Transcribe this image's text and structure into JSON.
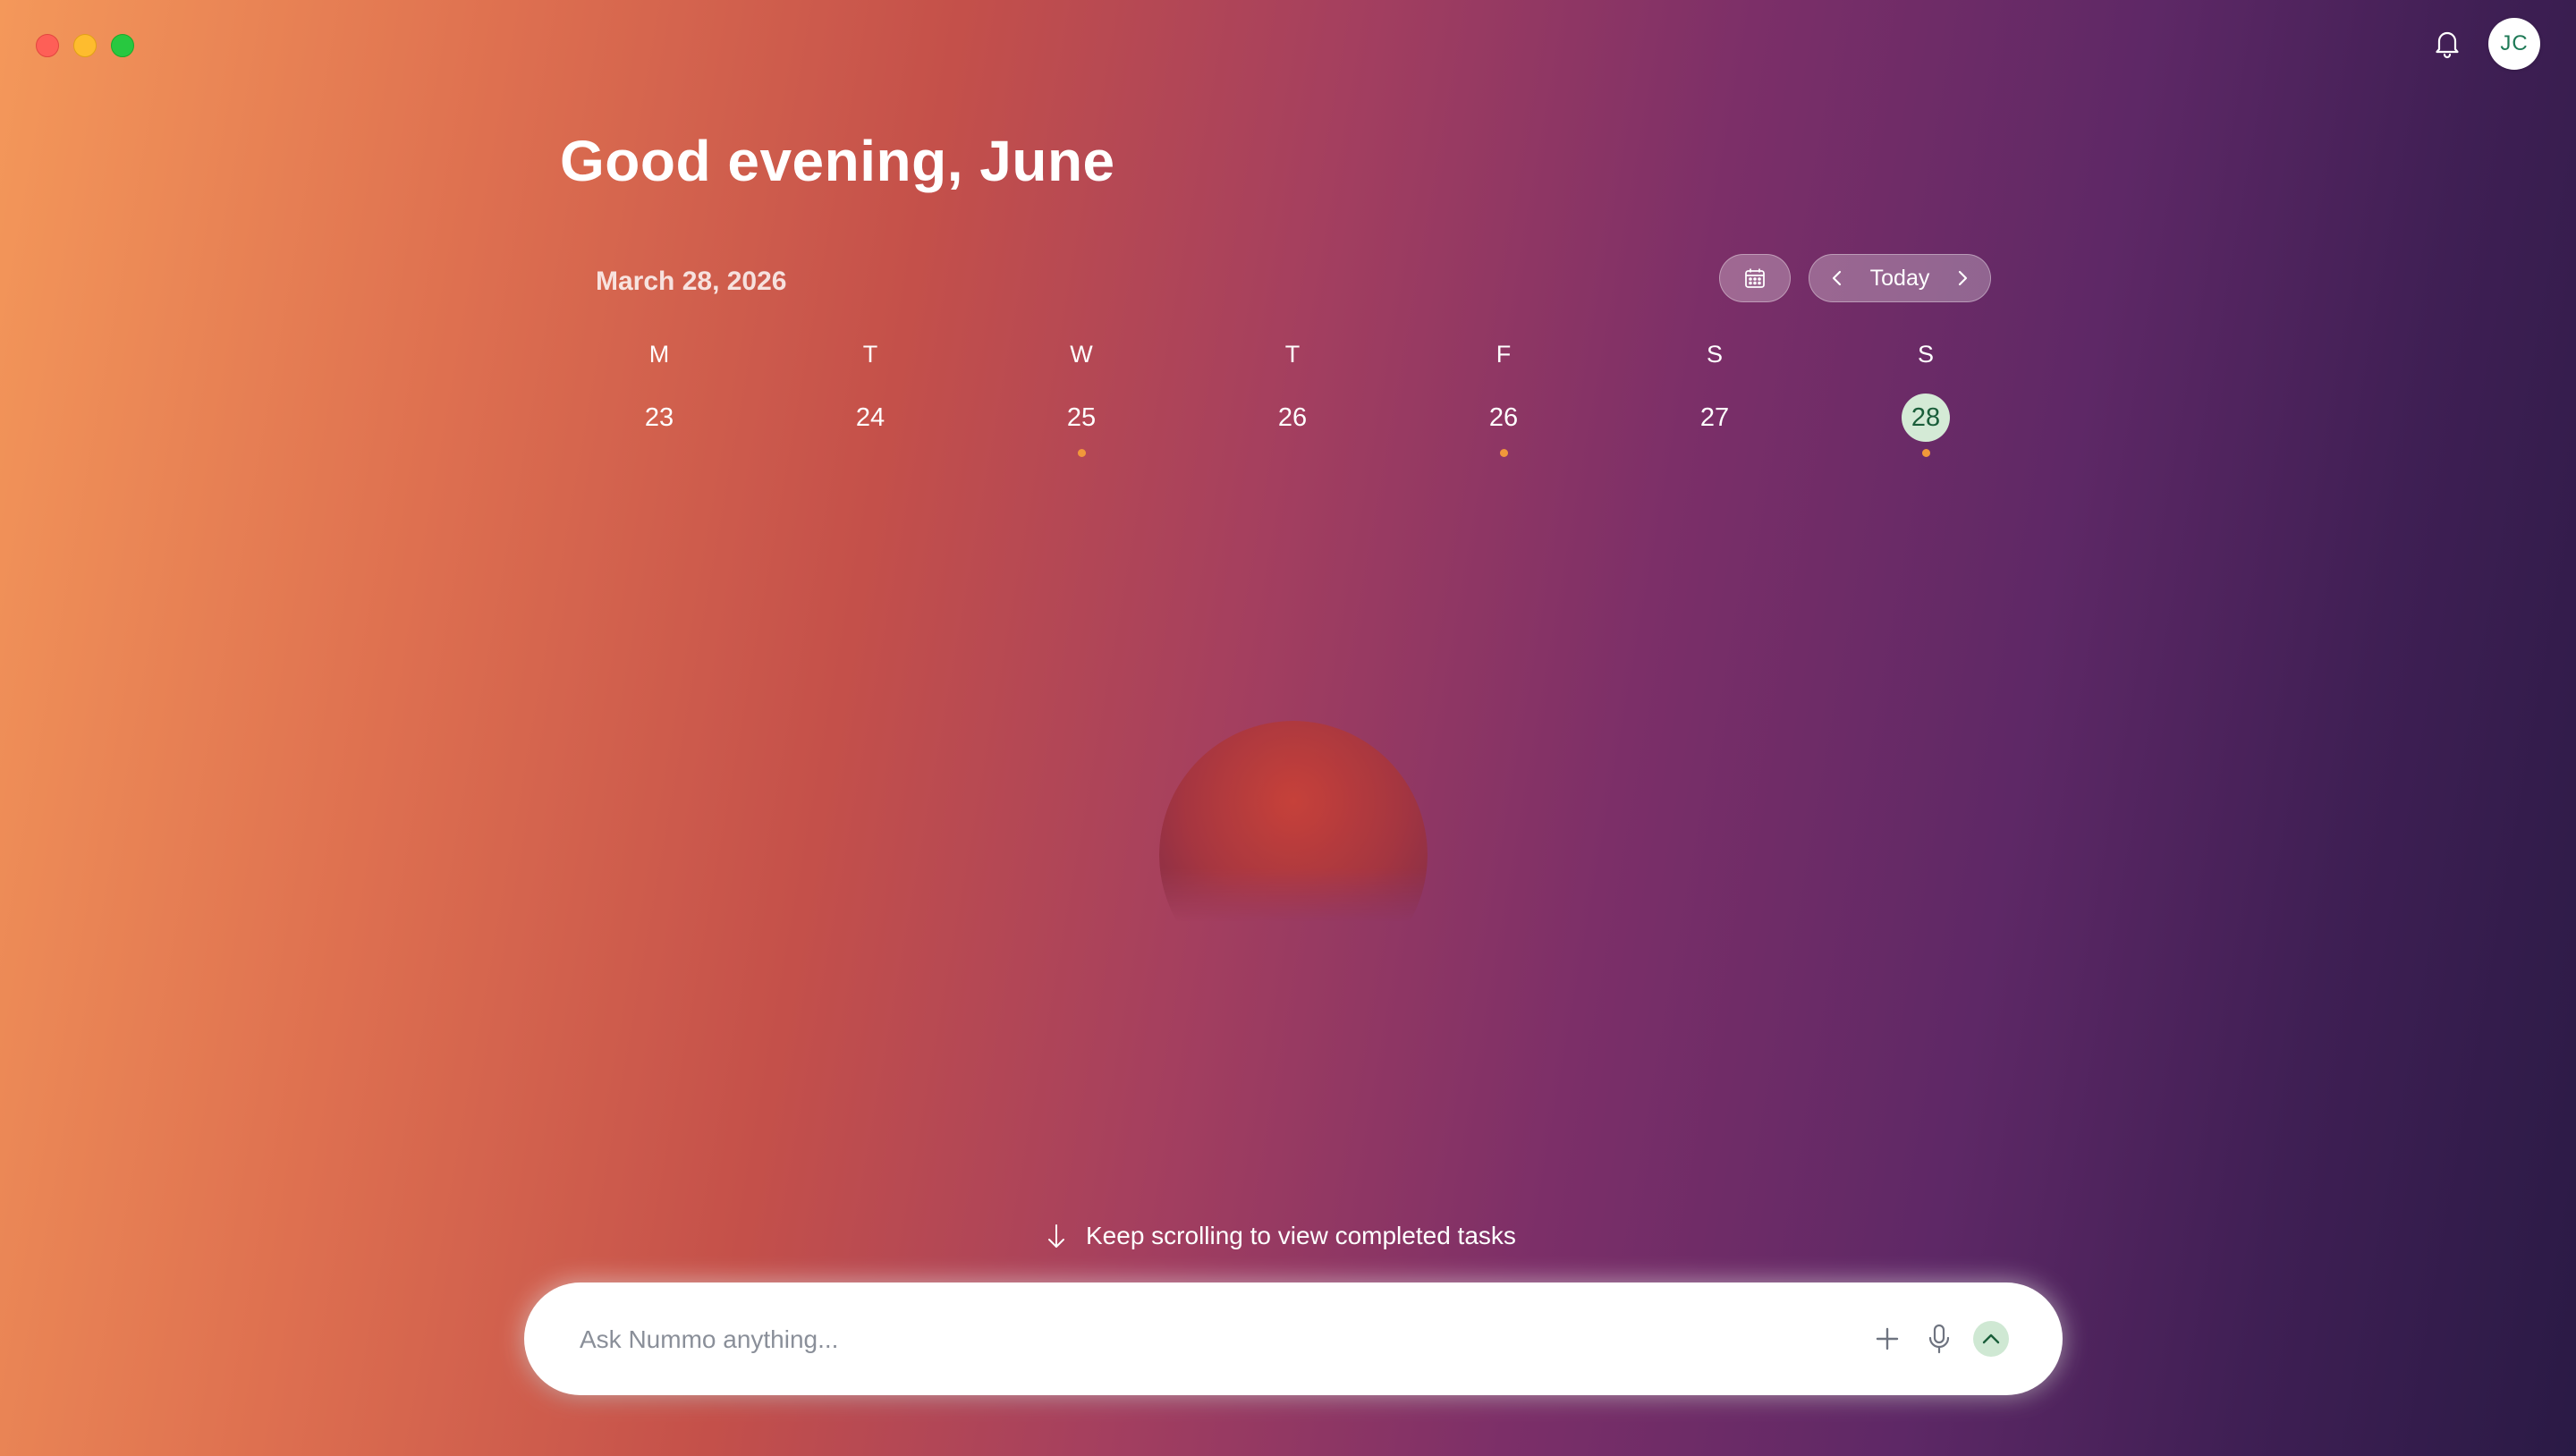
{
  "window": {
    "controls": [
      "close",
      "minimize",
      "maximize"
    ]
  },
  "header": {
    "bell_icon": "bell-icon",
    "avatar_initials": "JC"
  },
  "greeting": "Good evening, June",
  "calendar": {
    "date_label": "March 28, 2026",
    "calendar_icon": "calendar-icon",
    "today_label": "Today",
    "days": [
      {
        "dow": "M",
        "num": "23",
        "has_event": false,
        "selected": false
      },
      {
        "dow": "T",
        "num": "24",
        "has_event": false,
        "selected": false
      },
      {
        "dow": "W",
        "num": "25",
        "has_event": true,
        "selected": false
      },
      {
        "dow": "T",
        "num": "26",
        "has_event": false,
        "selected": false
      },
      {
        "dow": "F",
        "num": "26",
        "has_event": true,
        "selected": false
      },
      {
        "dow": "S",
        "num": "27",
        "has_event": false,
        "selected": false
      },
      {
        "dow": "S",
        "num": "28",
        "has_event": true,
        "selected": true
      }
    ]
  },
  "hint": "Keep scrolling to view completed tasks",
  "composer": {
    "placeholder": "Ask Nummo anything...",
    "value": ""
  },
  "colors": {
    "accent_green": "#cfe8d3",
    "event_dot": "#f1983a",
    "avatar_text": "#1f7a57"
  }
}
